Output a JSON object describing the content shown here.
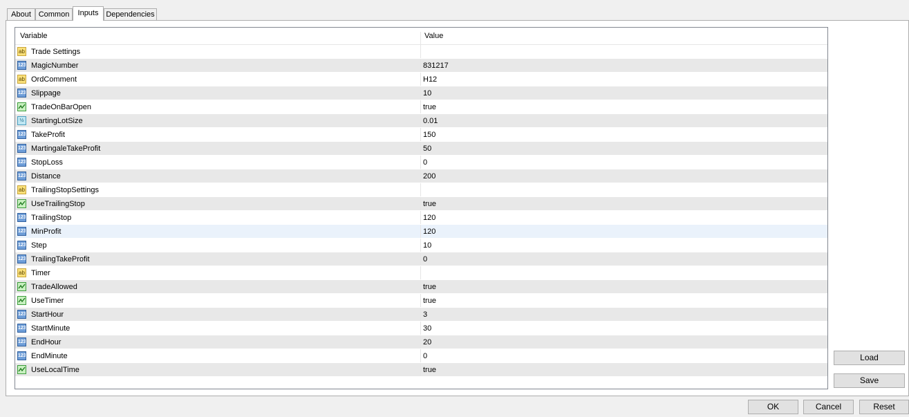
{
  "tabs": [
    "About",
    "Common",
    "Inputs",
    "Dependencies"
  ],
  "active_tab": "Inputs",
  "grid": {
    "columns": {
      "variable": "Variable",
      "value": "Value"
    },
    "rows": [
      {
        "icon": "string-icon",
        "name": "Trade Settings",
        "value": ""
      },
      {
        "icon": "integer-icon",
        "name": "MagicNumber",
        "value": "831217"
      },
      {
        "icon": "string-icon",
        "name": "OrdComment",
        "value": "H12"
      },
      {
        "icon": "integer-icon",
        "name": "Slippage",
        "value": "10"
      },
      {
        "icon": "boolean-icon",
        "name": "TradeOnBarOpen",
        "value": "true"
      },
      {
        "icon": "double-icon",
        "name": "StartingLotSize",
        "value": "0.01"
      },
      {
        "icon": "integer-icon",
        "name": "TakeProfit",
        "value": "150"
      },
      {
        "icon": "integer-icon",
        "name": "MartingaleTakeProfit",
        "value": "50"
      },
      {
        "icon": "integer-icon",
        "name": "StopLoss",
        "value": "0"
      },
      {
        "icon": "integer-icon",
        "name": "Distance",
        "value": "200"
      },
      {
        "icon": "string-icon",
        "name": "TrailingStopSettings",
        "value": ""
      },
      {
        "icon": "boolean-icon",
        "name": "UseTrailingStop",
        "value": "true"
      },
      {
        "icon": "integer-icon",
        "name": "TrailingStop",
        "value": "120"
      },
      {
        "icon": "integer-icon",
        "name": "MinProfit",
        "value": "120"
      },
      {
        "icon": "integer-icon",
        "name": "Step",
        "value": "10"
      },
      {
        "icon": "integer-icon",
        "name": "TrailingTakeProfit",
        "value": "0"
      },
      {
        "icon": "string-icon",
        "name": "Timer",
        "value": ""
      },
      {
        "icon": "boolean-icon",
        "name": "TradeAllowed",
        "value": "true"
      },
      {
        "icon": "boolean-icon",
        "name": "UseTimer",
        "value": "true"
      },
      {
        "icon": "integer-icon",
        "name": "StartHour",
        "value": "3"
      },
      {
        "icon": "integer-icon",
        "name": "StartMinute",
        "value": "30"
      },
      {
        "icon": "integer-icon",
        "name": "EndHour",
        "value": "20"
      },
      {
        "icon": "integer-icon",
        "name": "EndMinute",
        "value": "0"
      },
      {
        "icon": "boolean-icon",
        "name": "UseLocalTime",
        "value": "true"
      }
    ],
    "hovered_row": "MinProfit"
  },
  "icon_glyphs": {
    "string-icon": "ab",
    "integer-icon": "123",
    "double-icon": "½"
  },
  "side_buttons": {
    "load": "Load",
    "save": "Save"
  },
  "footer_buttons": {
    "ok": "OK",
    "cancel": "Cancel",
    "reset": "Reset"
  }
}
